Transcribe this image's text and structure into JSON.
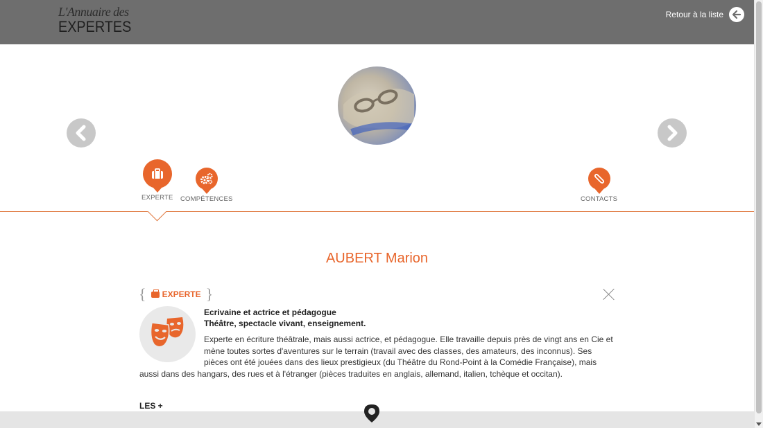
{
  "header": {
    "logo_line1": "L'Annuaire des",
    "logo_line2": "EXPERTES",
    "back_label": "Retour à la liste"
  },
  "tabs": [
    {
      "label": "EXPERTE",
      "icon": "briefcase-icon"
    },
    {
      "label": "COMPÉTENCES",
      "icon": "gears-icon"
    },
    {
      "label": "CONTACTS",
      "icon": "paperclip-icon"
    }
  ],
  "profile": {
    "name": "AUBERT Marion",
    "section_title": "EXPERTE",
    "role_line1": "Ecrivaine et actrice et pédagogue",
    "role_line2": "Théâtre, spectacle vivant, enseignement.",
    "description_lines": [
      "Experte en écriture théâtrale, mais aussi actrice, et pédagogue. Elle travaille depuis près de vingt ans en Cie et",
      "mène toutes sortes d'aventures sur le terrain (travail avec des classes,  des amateurs,  des inconnus).  Ses",
      "pièces ont été jouées dans des lieux prestigieux (du Théâtre du Rond-Point à la Comédie Française),  mais",
      "aussi dans des hangars,  des rues et à l'étranger (pièces traduites en anglais, allemand, italien, tchèque et occitan)."
    ],
    "plus_label": "LES +"
  },
  "colors": {
    "accent": "#e8662c",
    "header_bg": "#6e6e6e"
  }
}
